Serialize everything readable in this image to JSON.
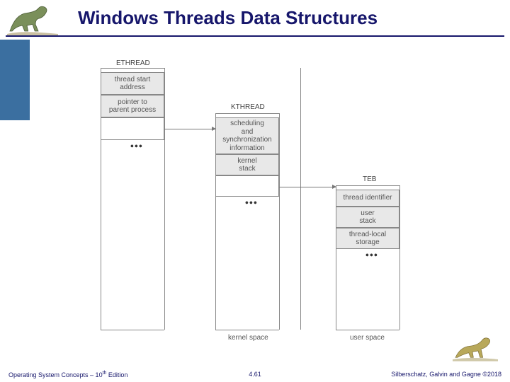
{
  "title": "Windows Threads Data Structures",
  "footer": {
    "left_a": "Operating System Concepts – 10",
    "left_sup": "th",
    "left_b": " Edition",
    "center": "4.61",
    "right": "Silberschatz, Galvin and Gagne ©2018"
  },
  "diagram": {
    "headers": {
      "ethread": "ETHREAD",
      "kthread": "KTHREAD",
      "teb": "TEB"
    },
    "ethread": {
      "b1": "thread start\naddress",
      "b2": "pointer to\nparent process"
    },
    "kthread": {
      "b1": "scheduling\nand\nsynchronization\ninformation",
      "b2": "kernel\nstack"
    },
    "teb": {
      "b1": "thread identifier",
      "b2": "user\nstack",
      "b3": "thread-local\nstorage"
    },
    "labels": {
      "kernel": "kernel space",
      "user": "user space"
    }
  }
}
